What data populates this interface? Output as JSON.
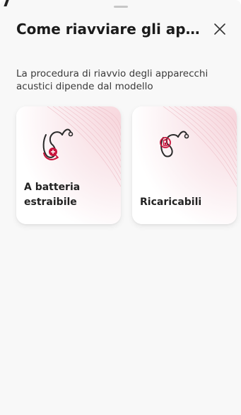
{
  "sheet": {
    "title": "Come riavviare gli appar...",
    "subtitle": "La procedura di riavvio degli apparecchi acustici dipende dal modello",
    "close_icon": "close-icon"
  },
  "cards": [
    {
      "label": "A batteria estraibile",
      "icon": "removable-battery-hearing-aid-icon"
    },
    {
      "label": "Ricaricabili",
      "icon": "rechargeable-hearing-aid-icon"
    }
  ],
  "colors": {
    "accent": "#c8143c",
    "text": "#1b1b1b",
    "background": "#f8f8f8",
    "card": "#ffffff"
  }
}
